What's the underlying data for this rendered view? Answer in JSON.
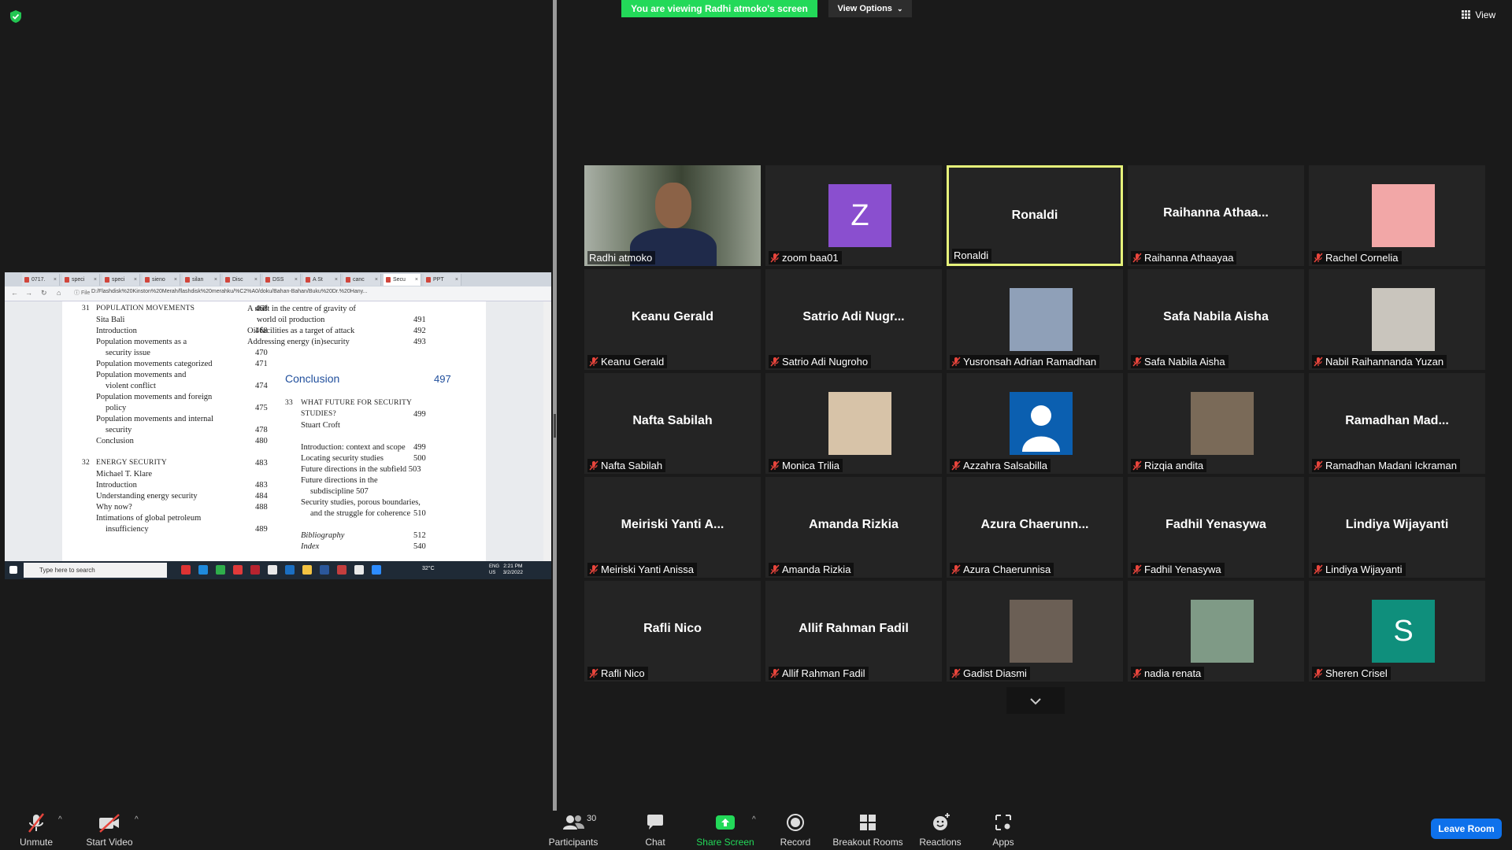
{
  "banner": {
    "viewing_text": "You are viewing Radhi atmoko's screen",
    "view_options_label": "View Options"
  },
  "view_button": {
    "label": "View"
  },
  "shared_screen": {
    "tabs": [
      "0717.",
      "speci",
      "speci",
      "sieno",
      "silan",
      "Disc",
      "DSS",
      "A St",
      "canc",
      "Secu",
      "PPT"
    ],
    "active_tab_index": 9,
    "url": "D:/Flashdisk%20Kinston%20Merah/flashdisk%20merahku/%C2%A0/doku/Bahan-Bahan/Buku%20Dr.%20Hany...",
    "pdf": {
      "left_col": [
        {
          "num": "31",
          "text": "POPULATION MOVEMENTS",
          "page": "468",
          "cap": true
        },
        {
          "text": "Sita Bali",
          "indent": 1
        },
        {
          "text": "Introduction",
          "page": "468",
          "indent": 1
        },
        {
          "text": "Population movements as a",
          "indent": 1
        },
        {
          "text": "security issue",
          "page": "470",
          "indent": 2
        },
        {
          "text": "Population movements categorized",
          "page": "471",
          "indent": 1
        },
        {
          "text": "Population movements and",
          "indent": 1
        },
        {
          "text": "violent conflict",
          "page": "474",
          "indent": 2
        },
        {
          "text": "Population movements and foreign",
          "indent": 1
        },
        {
          "text": "policy",
          "page": "475",
          "indent": 2
        },
        {
          "text": "Population movements and internal",
          "indent": 1
        },
        {
          "text": "security",
          "page": "478",
          "indent": 2
        },
        {
          "text": "Conclusion",
          "page": "480",
          "indent": 1
        },
        {
          "num": "32",
          "text": "ENERGY SECURITY",
          "page": "483",
          "cap": true,
          "gap": true
        },
        {
          "text": "Michael T. Klare",
          "indent": 1
        },
        {
          "text": "Introduction",
          "page": "483",
          "indent": 1
        },
        {
          "text": "Understanding energy security",
          "page": "484",
          "indent": 1
        },
        {
          "text": "Why now?",
          "page": "488",
          "indent": 1
        },
        {
          "text": "Intimations of global petroleum",
          "indent": 1
        },
        {
          "text": "insufficiency",
          "page": "489",
          "indent": 2
        }
      ],
      "right_top": [
        {
          "text": "A shift in the centre of gravity of",
          "indent": 1
        },
        {
          "text": "world oil production",
          "page": "491",
          "indent": 2
        },
        {
          "text": "Oil facilities as a target of attack",
          "page": "492",
          "indent": 1
        },
        {
          "text": "Addressing energy (in)security",
          "page": "493",
          "indent": 1
        }
      ],
      "conclusion": {
        "text": "Conclusion",
        "page": "497"
      },
      "right_bottom": [
        {
          "num": "33",
          "text": "WHAT FUTURE FOR SECURITY",
          "cap": true
        },
        {
          "text": "STUDIES?",
          "page": "499",
          "cap": true,
          "indent": 1
        },
        {
          "text": "Stuart Croft",
          "indent": 1
        },
        {
          "text": "Introduction: context and scope",
          "page": "499",
          "indent": 1,
          "gap": true
        },
        {
          "text": "Locating security studies",
          "page": "500",
          "indent": 1
        },
        {
          "text": "Future directions in the subfield 503",
          "indent": 1
        },
        {
          "text": "Future directions in the",
          "indent": 1
        },
        {
          "text": "subdiscipline 507",
          "indent": 2
        },
        {
          "text": "Security studies, porous boundaries,",
          "indent": 1
        },
        {
          "text": "and the struggle for coherence",
          "page": "510",
          "indent": 2
        },
        {
          "text": "Bibliography",
          "page": "512",
          "italic": true,
          "gap": true
        },
        {
          "text": "Index",
          "page": "540",
          "italic": true
        }
      ]
    },
    "taskbar": {
      "search_placeholder": "Type here to search",
      "weather": "32°C",
      "lang": "ENG\nUS",
      "time": "2:21 PM",
      "date": "3/2/2022"
    }
  },
  "participants": [
    {
      "display": "",
      "label": "Radhi atmoko",
      "muted": false,
      "avatar": "video-photo"
    },
    {
      "display": "",
      "label": "zoom baa01",
      "muted": true,
      "avatar": "letter",
      "letter": "Z",
      "color": "#8a4fcf"
    },
    {
      "display": "Ronaldi",
      "label": "Ronaldi",
      "muted": false,
      "avatar": "none",
      "speaker": true
    },
    {
      "display": "Raihanna  Athaa...",
      "label": "Raihanna Athaayaa",
      "muted": true,
      "avatar": "none"
    },
    {
      "display": "",
      "label": "Rachel Cornelia",
      "muted": true,
      "avatar": "solid",
      "color": "#f2a7a7"
    },
    {
      "display": "Keanu Gerald",
      "label": "Keanu Gerald",
      "muted": true,
      "avatar": "none"
    },
    {
      "display": "Satrio  Adi  Nugr...",
      "label": "Satrio Adi Nugroho",
      "muted": true,
      "avatar": "none"
    },
    {
      "display": "",
      "label": "Yusronsah Adrian Ramadhan",
      "muted": true,
      "avatar": "photo",
      "color": "#8fa0b8"
    },
    {
      "display": "Safa Nabila Aisha",
      "label": "Safa Nabila Aisha",
      "muted": true,
      "avatar": "none"
    },
    {
      "display": "",
      "label": "Nabil Raihannanda Yuzan",
      "muted": true,
      "avatar": "photo",
      "color": "#c9c5bd"
    },
    {
      "display": "Nafta Sabilah",
      "label": "Nafta Sabilah",
      "muted": true,
      "avatar": "none"
    },
    {
      "display": "",
      "label": "Monica Trilia",
      "muted": true,
      "avatar": "photo",
      "color": "#d7c3a8"
    },
    {
      "display": "",
      "label": "Azzahra Salsabilla",
      "muted": true,
      "avatar": "person-icon",
      "color": "#0b5fb0"
    },
    {
      "display": "",
      "label": "Rizqia andita",
      "muted": true,
      "avatar": "photo",
      "color": "#7a6a58"
    },
    {
      "display": "Ramadhan  Mad...",
      "label": "Ramadhan Madani Ickraman",
      "muted": true,
      "avatar": "none"
    },
    {
      "display": "Meiriski  Yanti  A...",
      "label": "Meiriski Yanti Anissa",
      "muted": true,
      "avatar": "none"
    },
    {
      "display": "Amanda Rizkia",
      "label": "Amanda Rizkia",
      "muted": true,
      "avatar": "none"
    },
    {
      "display": "Azura  Chaerunn...",
      "label": "Azura Chaerunnisa",
      "muted": true,
      "avatar": "none"
    },
    {
      "display": "Fadhil Yenasywa",
      "label": "Fadhil Yenasywa",
      "muted": true,
      "avatar": "none"
    },
    {
      "display": "Lindiya Wijayanti",
      "label": "Lindiya Wijayanti",
      "muted": true,
      "avatar": "none"
    },
    {
      "display": "Rafli Nico",
      "label": "Rafli Nico",
      "muted": true,
      "avatar": "none"
    },
    {
      "display": "Allif Rahman Fadil",
      "label": "Allif Rahman Fadil",
      "muted": true,
      "avatar": "none"
    },
    {
      "display": "",
      "label": "Gadist Diasmi",
      "muted": true,
      "avatar": "photo",
      "color": "#6b5f55"
    },
    {
      "display": "",
      "label": "nadia renata",
      "muted": true,
      "avatar": "photo",
      "color": "#7f9a86"
    },
    {
      "display": "",
      "label": "Sheren Crisel",
      "muted": true,
      "avatar": "letter",
      "letter": "S",
      "color": "#0f8f7c"
    }
  ],
  "toolbar": {
    "unmute": "Unmute",
    "start_video": "Start Video",
    "participants": "Participants",
    "participants_count": "30",
    "chat": "Chat",
    "share_screen": "Share Screen",
    "record": "Record",
    "breakout": "Breakout Rooms",
    "reactions": "Reactions",
    "apps": "Apps",
    "leave": "Leave Room"
  },
  "colors": {
    "share_green": "#23d959",
    "leave_blue": "#0e71eb",
    "speaker_border": "#e6f27a",
    "muted_red": "#e8453c"
  }
}
